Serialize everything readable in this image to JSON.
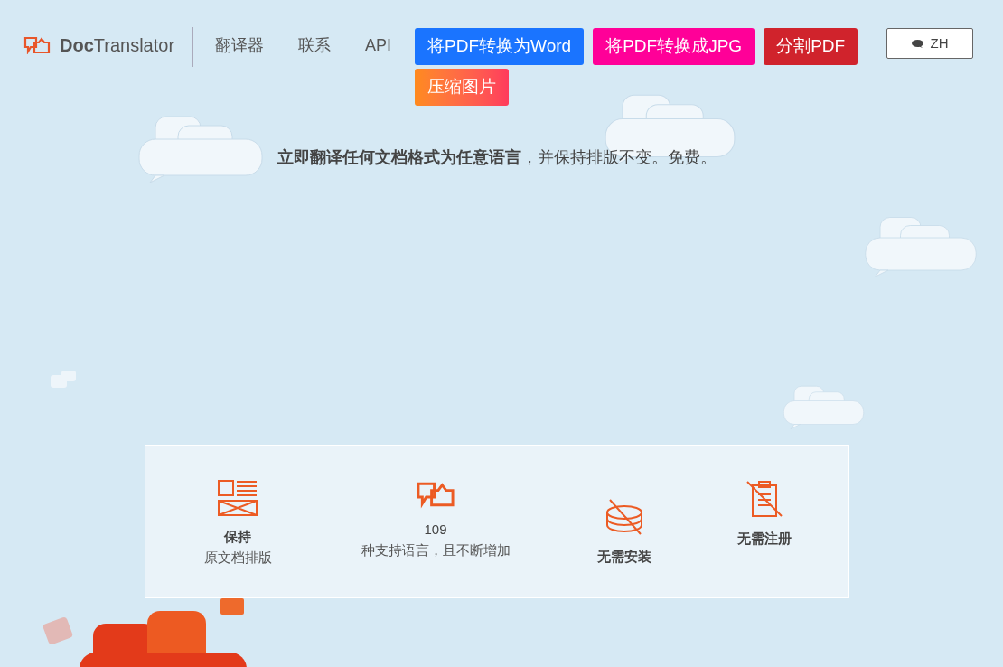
{
  "logo": {
    "text": "**Doc**Translator"
  },
  "nav": [
    "翻译器",
    "联系",
    "API"
  ],
  "tool_buttons": [
    {
      "label": "将PDF转换为Word",
      "kind": "solid",
      "color": "#1a74ff"
    },
    {
      "label": "将PDF转换成JPG",
      "kind": "solid",
      "color": "#ff0098"
    },
    {
      "label": "分割PDF",
      "kind": "solid",
      "color": "#d0232c"
    },
    {
      "label": "压缩图片",
      "kind": "gradient"
    }
  ],
  "language_button": {
    "label": "ZH"
  },
  "tagline": "**立即翻译任何文档格式为任意语言**，并保持排版不变。免费。",
  "features": [
    {
      "kind": "layout",
      "title": "保持",
      "bold": true,
      "subtitle": "原文档排版"
    },
    {
      "kind": "languages",
      "title": "109",
      "bold": false,
      "subtitle": "种支持语言，且不断增加"
    },
    {
      "kind": "install",
      "title": "无需安装",
      "bold": true
    },
    {
      "kind": "register",
      "title": "无需注册",
      "bold": true
    }
  ]
}
